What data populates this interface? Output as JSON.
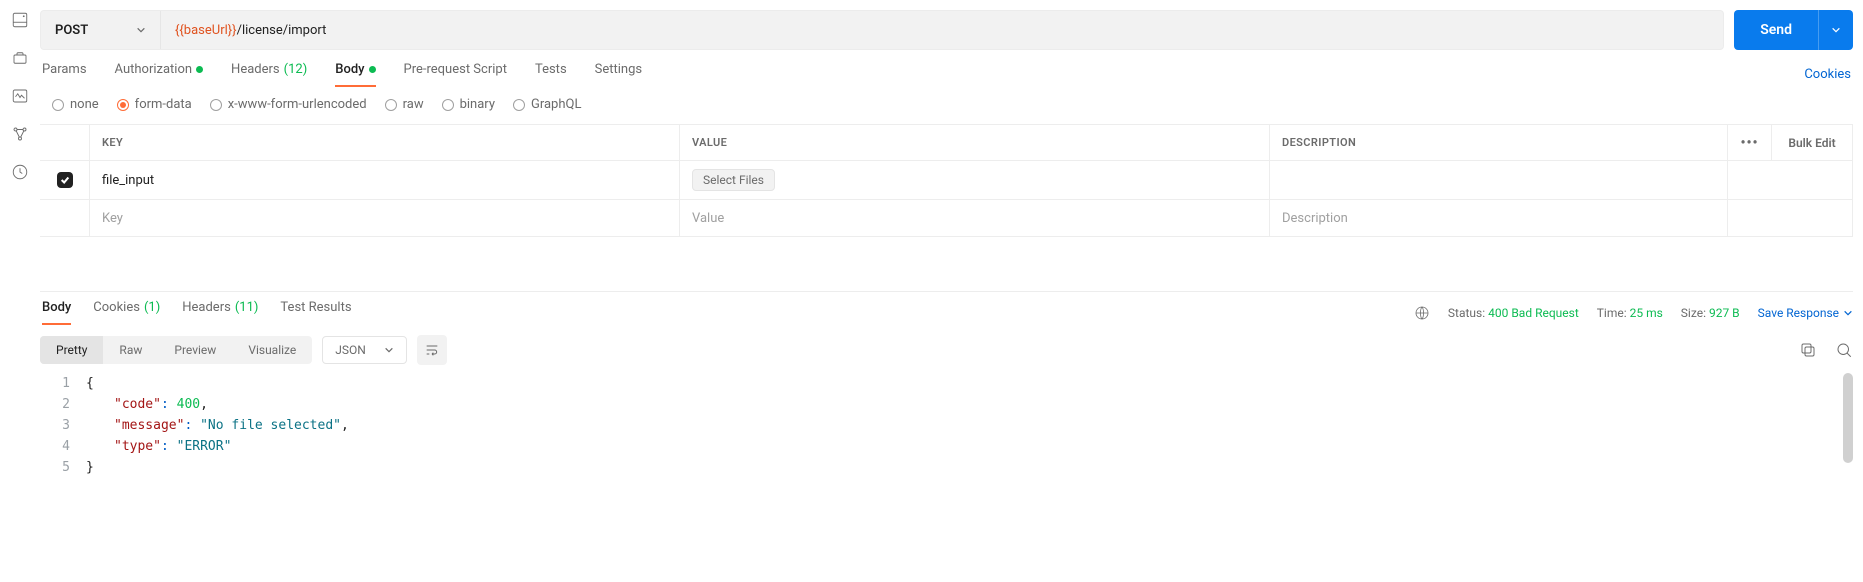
{
  "request": {
    "method": "POST",
    "url_var": "{{baseUrl}}",
    "url_path": "/license/import",
    "send_label": "Send"
  },
  "req_tabs": {
    "params": "Params",
    "authorization": "Authorization",
    "headers_label": "Headers",
    "headers_count": "(12)",
    "body": "Body",
    "prereq": "Pre-request Script",
    "tests": "Tests",
    "settings": "Settings",
    "cookies_link": "Cookies"
  },
  "body_types": {
    "none": "none",
    "form_data": "form-data",
    "xwww": "x-www-form-urlencoded",
    "raw": "raw",
    "binary": "binary",
    "graphql": "GraphQL"
  },
  "fd_table": {
    "header_key": "KEY",
    "header_value": "VALUE",
    "header_desc": "DESCRIPTION",
    "bulk_edit": "Bulk Edit",
    "rows": [
      {
        "key": "file_input",
        "value_button": "Select Files",
        "desc": ""
      }
    ],
    "placeholder_key": "Key",
    "placeholder_value": "Value",
    "placeholder_desc": "Description"
  },
  "resp_tabs": {
    "body": "Body",
    "cookies": "Cookies",
    "cookies_count": "(1)",
    "headers": "Headers",
    "headers_count": "(11)",
    "test_results": "Test Results"
  },
  "resp_meta": {
    "status_label": "Status:",
    "status_value": "400 Bad Request",
    "time_label": "Time:",
    "time_value": "25 ms",
    "size_label": "Size:",
    "size_value": "927 B",
    "save_response": "Save Response"
  },
  "resp_view": {
    "pretty": "Pretty",
    "raw": "Raw",
    "preview": "Preview",
    "visualize": "Visualize",
    "format": "JSON"
  },
  "response_body": {
    "l1_open": "{",
    "l2_key": "\"code\"",
    "l2_val": "400",
    "l2_comma": ",",
    "l3_key": "\"message\"",
    "l3_val": "\"No file selected\"",
    "l3_comma": ",",
    "l4_key": "\"type\"",
    "l4_val": "\"ERROR\"",
    "l5_close": "}"
  }
}
